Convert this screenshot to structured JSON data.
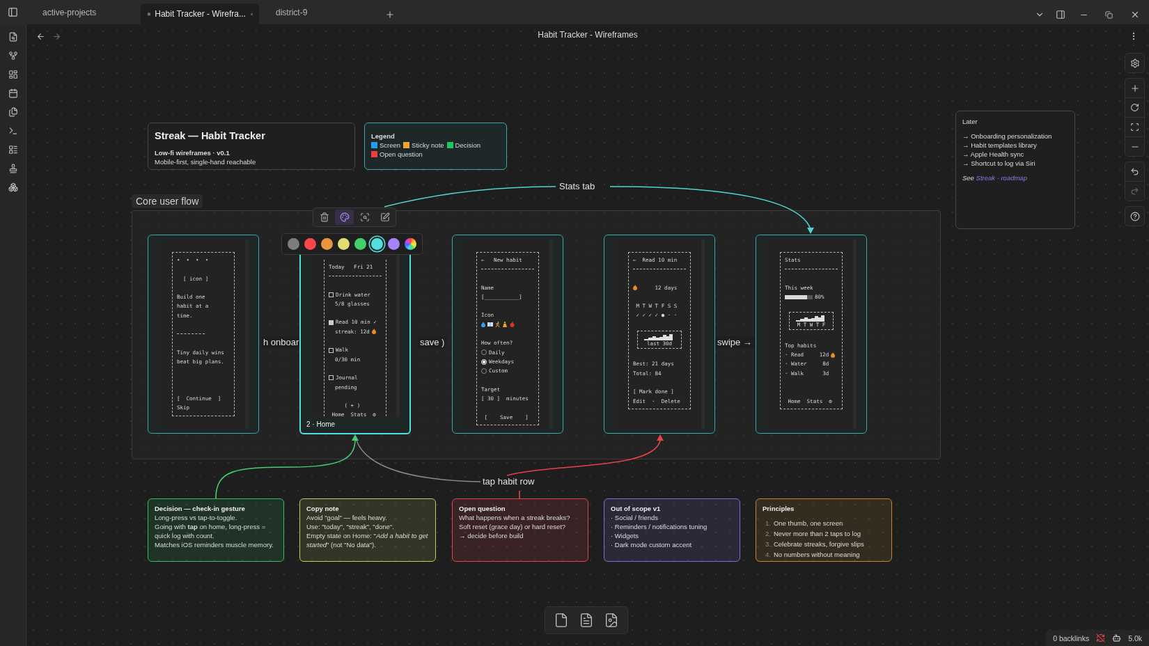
{
  "tabs": [
    {
      "label": "active-projects",
      "selected": false
    },
    {
      "label": "Habit Tracker - Wirefra...",
      "selected": true
    },
    {
      "label": "district-9",
      "selected": false
    }
  ],
  "view_title": "Habit Tracker - Wireframes",
  "title_card": {
    "title": "Streak — Habit Tracker",
    "subtitle": "Low-fi wireframes · v0.1",
    "description": "Mobile-first, single-hand reachable"
  },
  "legend": {
    "title": "Legend",
    "items": [
      {
        "label": "Screen",
        "color": "#1e9ff0"
      },
      {
        "label": "Sticky note",
        "color": "#f2a52b"
      },
      {
        "label": "Decision",
        "color": "#19c862"
      },
      {
        "label": "Open question",
        "color": "#f03c3c"
      }
    ]
  },
  "later": {
    "title": "Later",
    "items": [
      "→ Onboarding personalization",
      "→ Habit templates library",
      "→ Apple Health sync",
      "→ Shortcut to log via Siri"
    ],
    "see": "See",
    "link": "Streak - roadmap"
  },
  "group": {
    "label": "Core user flow"
  },
  "node_toolbar": [
    {
      "kind": "delete",
      "selected": false
    },
    {
      "kind": "color",
      "selected": true
    },
    {
      "kind": "zoom",
      "selected": false
    },
    {
      "kind": "edit",
      "selected": false
    }
  ],
  "palette": [
    {
      "kind": "swatch",
      "color": "#7d7d7d",
      "selected": false
    },
    {
      "kind": "swatch",
      "color": "#fb464c",
      "selected": false
    },
    {
      "kind": "swatch",
      "color": "#e9973f",
      "selected": false
    },
    {
      "kind": "swatch",
      "color": "#e0de71",
      "selected": false
    },
    {
      "kind": "swatch",
      "color": "#44cf6e",
      "selected": false
    },
    {
      "kind": "swatch",
      "color": "#53dfdd",
      "selected": true
    },
    {
      "kind": "swatch",
      "color": "#a882ff",
      "selected": false
    },
    {
      "kind": "custom",
      "selected": false
    }
  ],
  "screens": [
    {
      "selected": false,
      "color": "#3aa8a6",
      "lines": [
        {
          "kind": "text",
          "text": "•  •  •  •"
        },
        {
          "kind": "gap"
        },
        {
          "kind": "text",
          "text": "  [ icon ]"
        },
        {
          "kind": "gap"
        },
        {
          "kind": "text",
          "text": "Build one"
        },
        {
          "kind": "text",
          "text": "habit at a"
        },
        {
          "kind": "text",
          "text": "time."
        },
        {
          "kind": "gap"
        },
        {
          "kind": "short-rule"
        },
        {
          "kind": "gap"
        },
        {
          "kind": "text",
          "text": "Tiny daily wins"
        },
        {
          "kind": "text",
          "text": "beat big plans."
        },
        {
          "kind": "gap"
        },
        {
          "kind": "gap"
        },
        {
          "kind": "gap"
        },
        {
          "kind": "text",
          "text": "[  Continue  ]"
        },
        {
          "kind": "text",
          "text": "Skip"
        }
      ]
    },
    {
      "selected": true,
      "color": "#53dfdd",
      "caption": "2 · Home",
      "lines": [
        {
          "kind": "text",
          "text": "Today   Fri 21"
        },
        {
          "kind": "rule"
        },
        {
          "kind": "gap"
        },
        {
          "kind": "check",
          "checked": false,
          "text": "Drink water"
        },
        {
          "kind": "text",
          "text": "  5/8 glasses"
        },
        {
          "kind": "gap"
        },
        {
          "kind": "check",
          "checked": true,
          "text": "Read 10 min ✓"
        },
        {
          "kind": "text",
          "text": "  streak: 12d",
          "flame": true
        },
        {
          "kind": "gap"
        },
        {
          "kind": "check",
          "checked": false,
          "text": "Walk"
        },
        {
          "kind": "text",
          "text": "  0/30 min"
        },
        {
          "kind": "gap"
        },
        {
          "kind": "check",
          "checked": false,
          "text": "Journal"
        },
        {
          "kind": "text",
          "text": "  pending"
        },
        {
          "kind": "gap"
        },
        {
          "kind": "text",
          "text": "     ( + )"
        },
        {
          "kind": "text",
          "text": " Home  Stats  ⚙"
        }
      ]
    },
    {
      "selected": false,
      "color": "#3aa8a6",
      "lines": [
        {
          "kind": "text",
          "text": "←   New habit"
        },
        {
          "kind": "rule"
        },
        {
          "kind": "gap"
        },
        {
          "kind": "text",
          "text": "Name"
        },
        {
          "kind": "text",
          "text": "[___________]"
        },
        {
          "kind": "gap"
        },
        {
          "kind": "text",
          "text": "Icon"
        },
        {
          "kind": "icon-row"
        },
        {
          "kind": "gap"
        },
        {
          "kind": "text",
          "text": "How often?"
        },
        {
          "kind": "radio",
          "selected": false,
          "text": "Daily"
        },
        {
          "kind": "radio",
          "selected": true,
          "text": "Weekdays"
        },
        {
          "kind": "radio",
          "selected": false,
          "text": "Custom"
        },
        {
          "kind": "gap"
        },
        {
          "kind": "text",
          "text": "Target"
        },
        {
          "kind": "text",
          "text": "[ 30 ]  minutes"
        },
        {
          "kind": "gap"
        },
        {
          "kind": "text",
          "text": " [    Save    ]"
        }
      ]
    },
    {
      "selected": false,
      "color": "#3aa8a6",
      "lines": [
        {
          "kind": "text",
          "text": "←  Read 10 min"
        },
        {
          "kind": "rule"
        },
        {
          "kind": "gap"
        },
        {
          "kind": "text",
          "text": "     12 days",
          "flame_before": true
        },
        {
          "kind": "gap"
        },
        {
          "kind": "text",
          "text": " M T W T F S S"
        },
        {
          "kind": "text",
          "text": " ✓ ✓ ✓ ✓ ● · ·"
        },
        {
          "kind": "gap"
        },
        {
          "kind": "spark",
          "text": "last 30d"
        },
        {
          "kind": "gap"
        },
        {
          "kind": "text",
          "text": "Best: 21 days"
        },
        {
          "kind": "text",
          "text": "Total: 84"
        },
        {
          "kind": "gap"
        },
        {
          "kind": "text",
          "text": "[ Mark done ]"
        },
        {
          "kind": "text",
          "text": "Edit  ·  Delete"
        }
      ]
    },
    {
      "selected": false,
      "color": "#3aa8a6",
      "lines": [
        {
          "kind": "text",
          "text": "Stats"
        },
        {
          "kind": "rule"
        },
        {
          "kind": "gap"
        },
        {
          "kind": "text",
          "text": "This week"
        },
        {
          "kind": "bar",
          "level": 0.8,
          "text": "80%"
        },
        {
          "kind": "gap"
        },
        {
          "kind": "spark",
          "text": "M T W T F"
        },
        {
          "kind": "gap"
        },
        {
          "kind": "text",
          "text": "Top habits"
        },
        {
          "kind": "text",
          "text": "· Read     12d",
          "flame": true
        },
        {
          "kind": "text",
          "text": "· Water     8d"
        },
        {
          "kind": "text",
          "text": "· Walk      3d"
        },
        {
          "kind": "gap"
        },
        {
          "kind": "gap"
        },
        {
          "kind": "text",
          "text": " Home  Stats  ⚙"
        }
      ]
    }
  ],
  "edge_labels": [
    {
      "kind": "stats",
      "text": "Stats tab"
    },
    {
      "kind": "onboard",
      "text": "h onboar"
    },
    {
      "kind": "save",
      "text": "save )"
    },
    {
      "kind": "swipe",
      "text": "swipe →"
    },
    {
      "kind": "tap",
      "text": "tap habit row"
    }
  ],
  "notes": [
    {
      "color": "#2fbf5f",
      "title": "Decision — check-in gesture",
      "lines": [
        "Long-press vs tap-to-toggle.",
        "Going with **tap** on home, long-press = quick log with count.",
        "Matches iOS reminders muscle memory."
      ]
    },
    {
      "color": "#c9c765",
      "title": "Copy note",
      "lines": [
        "Avoid \"goal\" — feels heavy.",
        "Use: \"today\", \"streak\", \"done\".",
        "Empty state on Home: \"*Add a habit to get started*\" (not \"No data\")."
      ]
    },
    {
      "color": "#e5434a",
      "title": "Open question",
      "lines": [
        "What happens when a streak breaks?",
        "Soft reset (grace day) or hard reset?",
        "→ decide before build"
      ]
    },
    {
      "color": "#7a6fd8",
      "title": "Out of scope v1",
      "lines": [
        "· Social / friends",
        "· Reminders / notifications tuning",
        "· Widgets",
        "· Dark mode custom accent"
      ]
    },
    {
      "color": "#c7852f",
      "title": "Principles",
      "numbered": [
        {
          "number": "1.",
          "text": "One thumb, one screen"
        },
        {
          "number": "2.",
          "text": "Never more than 2 taps to log"
        },
        {
          "number": "3.",
          "text": "Celebrate streaks, forgive slips"
        },
        {
          "number": "4.",
          "text": "No numbers without meaning"
        }
      ]
    }
  ],
  "status_bar": {
    "backlinks": "0 backlinks",
    "words": "5.0k"
  }
}
